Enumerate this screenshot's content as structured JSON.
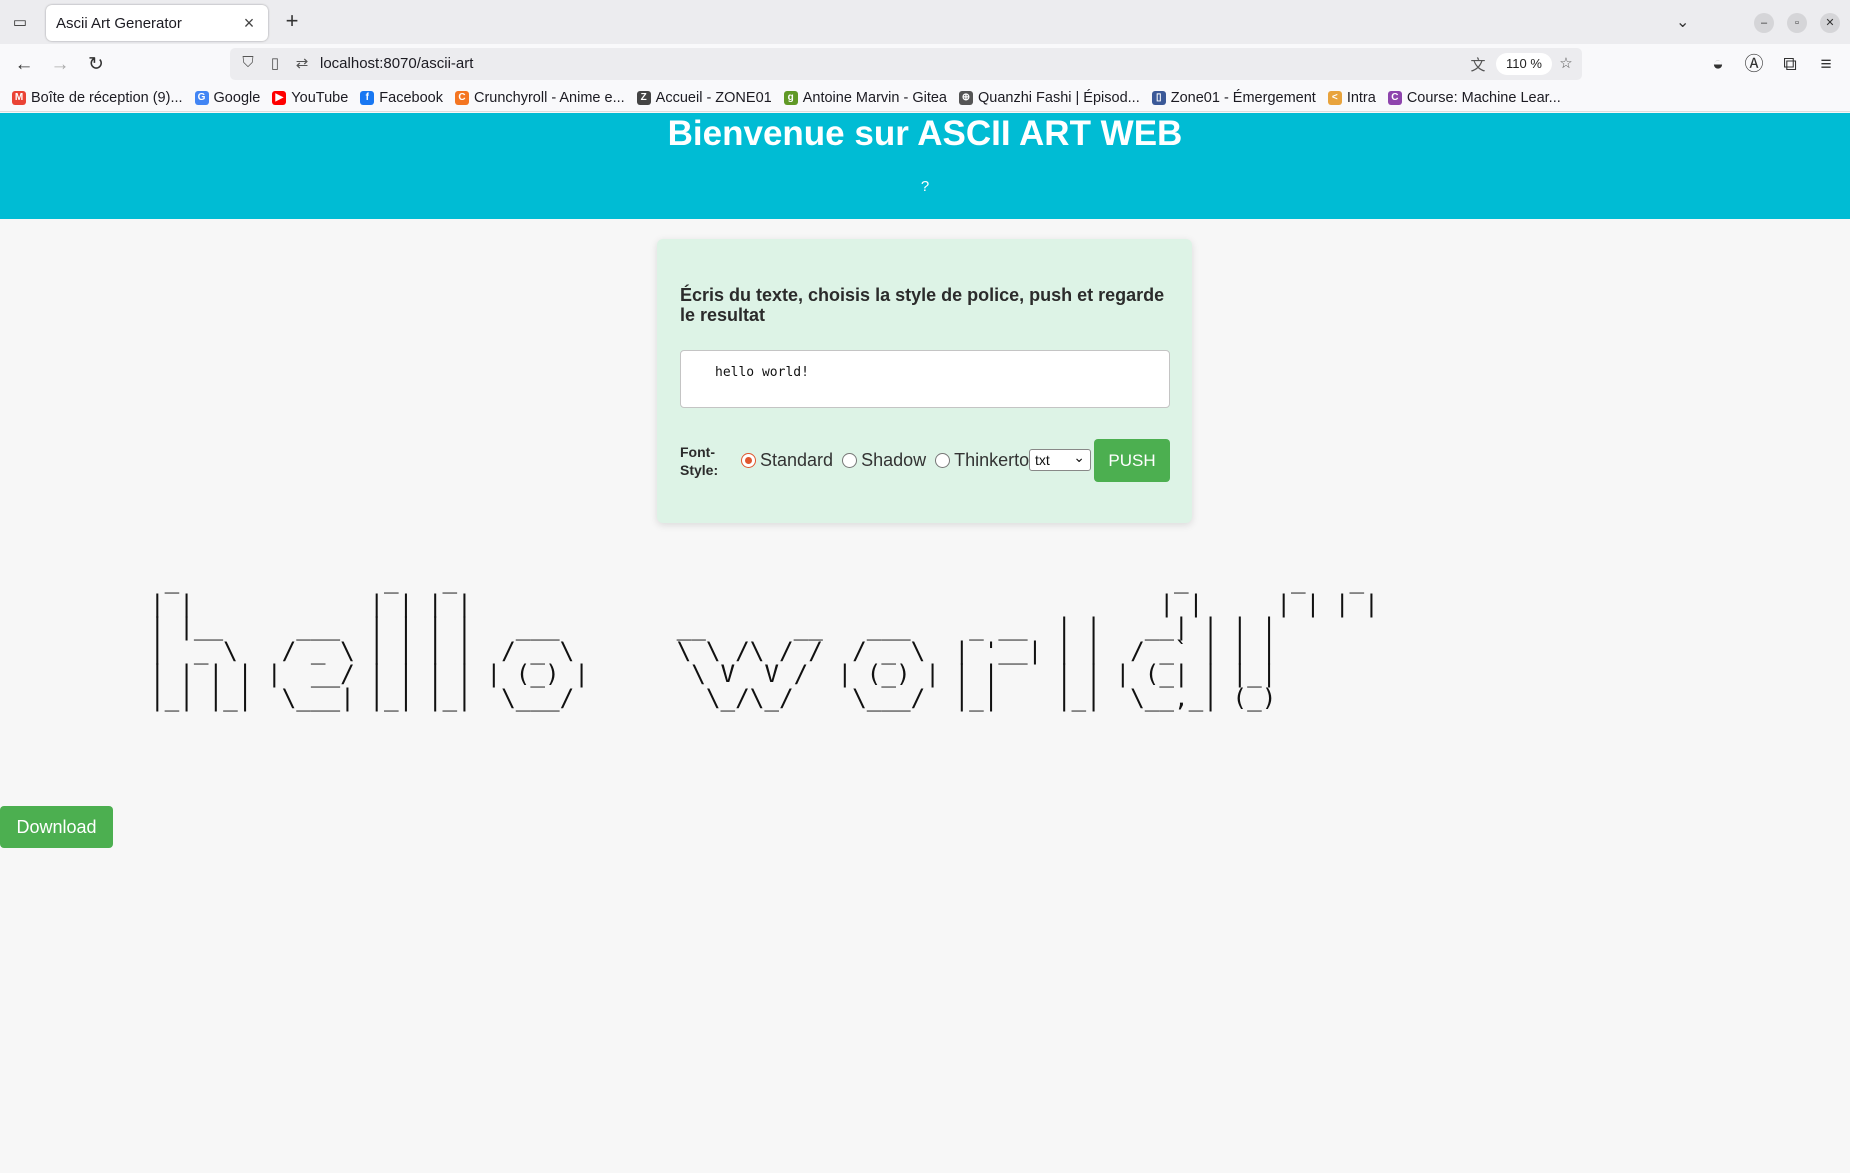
{
  "browser": {
    "tab_title": "Ascii Art Generator",
    "tab_close": "×",
    "new_tab": "+",
    "url": "localhost:8070/ascii-art",
    "zoom": "110 %",
    "bookmarks": [
      {
        "label": "Boîte de réception (9)...",
        "icon": "gmail-icon",
        "color": "#ea4335",
        "glyph": "M"
      },
      {
        "label": "Google",
        "icon": "google-icon",
        "color": "#4285f4",
        "glyph": "G"
      },
      {
        "label": "YouTube",
        "icon": "youtube-icon",
        "color": "#ff0000",
        "glyph": "▶"
      },
      {
        "label": "Facebook",
        "icon": "facebook-icon",
        "color": "#1877f2",
        "glyph": "f"
      },
      {
        "label": "Crunchyroll - Anime e...",
        "icon": "crunchyroll-icon",
        "color": "#f47521",
        "glyph": "C"
      },
      {
        "label": "Accueil - ZONE01",
        "icon": "zone01-icon",
        "color": "#444444",
        "glyph": "Z"
      },
      {
        "label": "Antoine Marvin - Gitea",
        "icon": "gitea-icon",
        "color": "#609926",
        "glyph": "g"
      },
      {
        "label": "Quanzhi Fashi | Épisod...",
        "icon": "globe-icon",
        "color": "#555555",
        "glyph": "⊕"
      },
      {
        "label": "Zone01 - Émergement",
        "icon": "document-icon",
        "color": "#3b5998",
        "glyph": "▯"
      },
      {
        "label": "Intra",
        "icon": "code-icon",
        "color": "#e8a33c",
        "glyph": "<"
      },
      {
        "label": "Course: Machine Lear...",
        "icon": "course-icon",
        "color": "#8e44ad",
        "glyph": "C"
      }
    ]
  },
  "page": {
    "title": "Bienvenue sur ASCII ART WEB",
    "help": "?",
    "form": {
      "heading": "Écris du texte, choisis la style de police, push et regarde le resultat",
      "input_value": "hello world!",
      "font_label": "Font-Style:",
      "fonts": [
        {
          "label": "Standard",
          "checked": true
        },
        {
          "label": "Shadow",
          "checked": false
        },
        {
          "label": "Thinkertoy",
          "checked": false
        }
      ],
      "format_selected": "txt",
      "push_label": "PUSH"
    },
    "ascii_output": " _              _   _                                                 _       _   _ \n| |            | | | |                                               | |     | | | |\n| |__     ___  | | | |   ___        __      __   ___    _ __  | |   __| | | |\n|  _ \\   / _ \\ | | | |  / _ \\       \\ \\ /\\ / /  / _ \\  | '__| | |  / _` | | |\n| | | | |  __/ | | | | | (_) |       \\ V  V /  | (_) | | |    | | | (_| | |_|\n|_| |_|  \\___| |_| |_|  \\___/         \\_/\\_/    \\___/  |_|    |_|  \\__,_| (_)",
    "download_label": "Download"
  },
  "colors": {
    "header_bg": "#00bcd4",
    "card_bg": "#ddf3e6",
    "button_green": "#4caf50",
    "radio_accent": "#e0552d"
  }
}
